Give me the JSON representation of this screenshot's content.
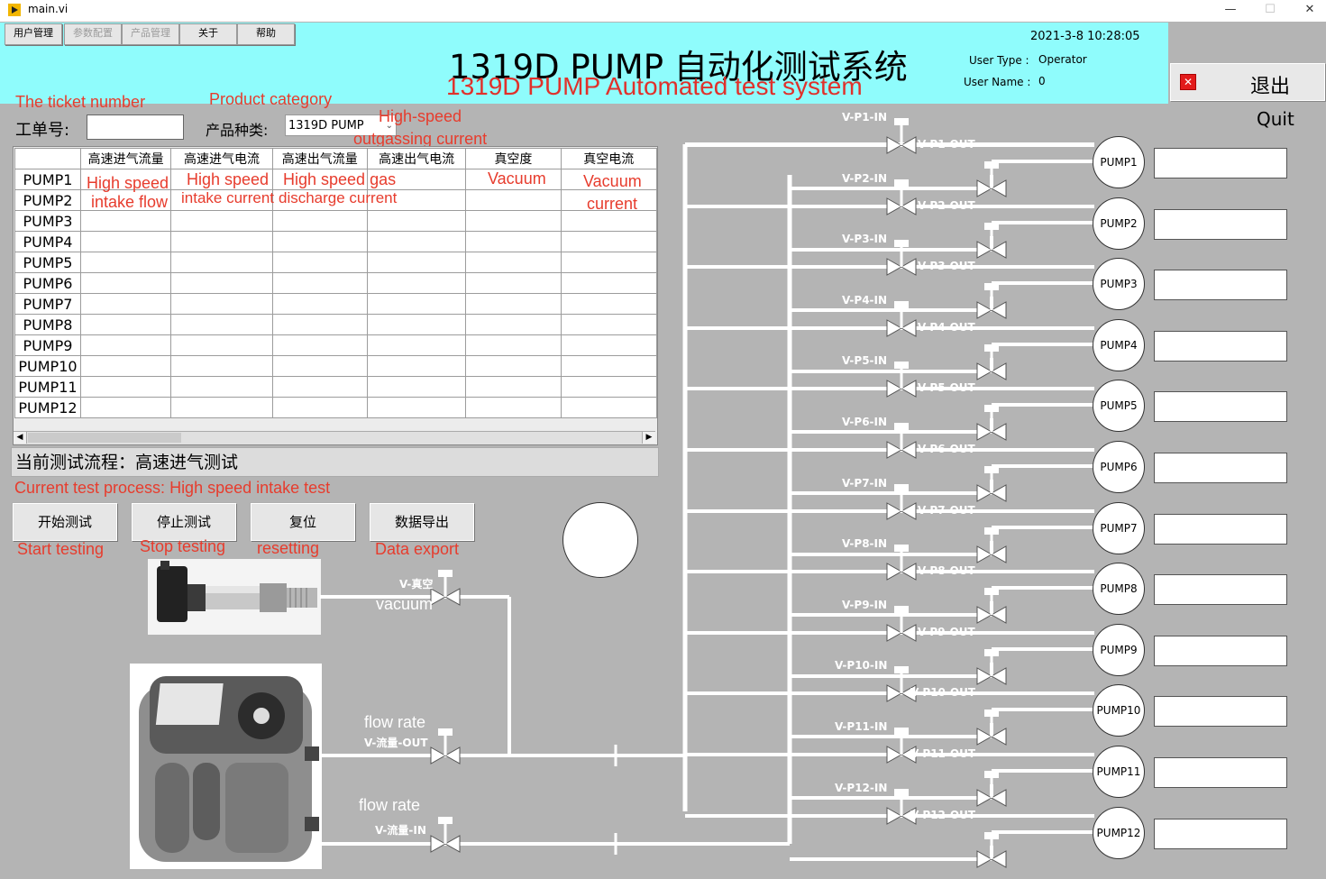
{
  "window": {
    "title": "main.vi",
    "min": "—",
    "max": "☐",
    "close": "✕"
  },
  "menu": [
    {
      "label": "用户管理",
      "enabled": true
    },
    {
      "label": "参数配置",
      "enabled": false
    },
    {
      "label": "产品管理",
      "enabled": false
    },
    {
      "label": "关于",
      "enabled": true
    },
    {
      "label": "帮助",
      "enabled": true
    }
  ],
  "header": {
    "title_cn": "1319D PUMP 自动化测试系统",
    "title_en": "1319D PUMP Automated test system",
    "datetime": "2021-3-8 10:28:05",
    "user_type_label": "User Type :",
    "user_type": "Operator",
    "user_name_label": "User Name :",
    "user_name": "0",
    "bg_color": "#8ffcfc"
  },
  "quit": {
    "label": "退出",
    "caption": "Quit"
  },
  "form": {
    "ticket_label_en": "The ticket number",
    "ticket_label": "工单号:",
    "ticket_value": "",
    "product_label_en": "Product category",
    "product_label": "产品种类:",
    "product_value": "1319D PUMP"
  },
  "annotations": {
    "high_speed_outgassing": "High-speed",
    "outgassing_current": "outgassing current",
    "col1": "High speed",
    "col1b": "intake flow",
    "col2": "High speed",
    "col2b": "intake current",
    "col3": "High speed gas",
    "col3b": "discharge current",
    "col5": "Vacuum",
    "col6": "Vacuum",
    "col6b": "current"
  },
  "table": {
    "columns": [
      "",
      "高速进气流量",
      "高速进气电流",
      "高速出气流量",
      "高速出气电流",
      "真空度",
      "真空电流"
    ],
    "rows": [
      "PUMP1",
      "PUMP2",
      "PUMP3",
      "PUMP4",
      "PUMP5",
      "PUMP6",
      "PUMP7",
      "PUMP8",
      "PUMP9",
      "PUMP10",
      "PUMP11",
      "PUMP12"
    ]
  },
  "status": {
    "text": "当前测试流程：高速进气测试",
    "caption": "Current test process:  High speed intake test"
  },
  "buttons": [
    {
      "label": "开始测试",
      "caption": "Start testing"
    },
    {
      "label": "停止测试",
      "caption": "Stop testing"
    },
    {
      "label": "复位",
      "caption": "resetting"
    },
    {
      "label": "数据导出",
      "caption": "Data export"
    }
  ],
  "diagram": {
    "vacuum_valve": "V-真空",
    "vacuum_caption": "vacuum",
    "flow_out_caption": "flow rate",
    "flow_out_valve": "V-流量-OUT",
    "flow_in_caption": "flow rate",
    "flow_in_valve": "V-流量-IN",
    "pumps": [
      {
        "name": "PUMP1",
        "in": "V-P1-IN",
        "out": "V-P1-OUT"
      },
      {
        "name": "PUMP2",
        "in": "V-P2-IN",
        "out": "V-P2-OUT"
      },
      {
        "name": "PUMP3",
        "in": "V-P3-IN",
        "out": "V-P3-OUT"
      },
      {
        "name": "PUMP4",
        "in": "V-P4-IN",
        "out": "V-P4-OUT"
      },
      {
        "name": "PUMP5",
        "in": "V-P5-IN",
        "out": "V-P5-OUT"
      },
      {
        "name": "PUMP6",
        "in": "V-P6-IN",
        "out": "V-P6-OUT"
      },
      {
        "name": "PUMP7",
        "in": "V-P7-IN",
        "out": "V-P7-OUT"
      },
      {
        "name": "PUMP8",
        "in": "V-P8-IN",
        "out": "V-P8-OUT"
      },
      {
        "name": "PUMP9",
        "in": "V-P9-IN",
        "out": "V-P9-OUT"
      },
      {
        "name": "PUMP10",
        "in": "V-P10-IN",
        "out": "V-P10-OUT"
      },
      {
        "name": "PUMP11",
        "in": "V-P11-IN",
        "out": "V-P11-OUT"
      },
      {
        "name": "PUMP12",
        "in": "V-P12-IN",
        "out": "V-P12-OUT"
      }
    ]
  }
}
